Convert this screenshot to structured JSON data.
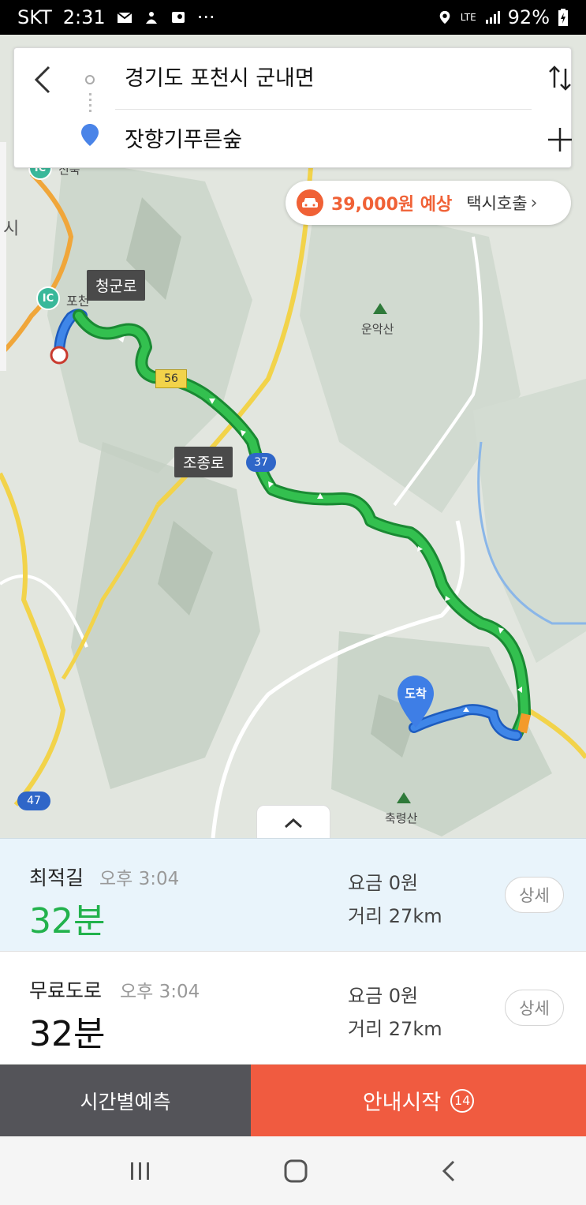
{
  "status_bar": {
    "carrier": "SKT",
    "time": "2:31",
    "more": "···",
    "network": "LTE",
    "battery": "92%"
  },
  "search": {
    "origin": "경기도 포천시 군내면",
    "destination": "잣향기푸른숲"
  },
  "taxi": {
    "fare": "39,000원 예상",
    "call_label": "택시호출",
    "chevron": "›"
  },
  "map": {
    "road_labels": [
      "청군로",
      "조종로"
    ],
    "route_numbers": [
      "56",
      "37",
      "47"
    ],
    "places": [
      "운악산",
      "축령산",
      "포천",
      "신북",
      "시"
    ],
    "ic_label": "IC",
    "arrival_label": "도착",
    "route_color": "#2fb84a",
    "route_outline": "#1f8a34"
  },
  "routes": [
    {
      "name": "최적길",
      "eta": "오후 3:04",
      "duration": "32분",
      "fare": "요금 0원",
      "distance": "거리 27km",
      "detail_label": "상세",
      "duration_color": "#22b24c"
    },
    {
      "name": "무료도로",
      "eta": "오후 3:04",
      "duration": "32분",
      "fare": "요금 0원",
      "distance": "거리 27km",
      "detail_label": "상세",
      "duration_color": "#111111"
    }
  ],
  "actions": {
    "forecast_label": "시간별예측",
    "start_label": "안내시작",
    "countdown": "14"
  },
  "colors": {
    "accent": "#f05b40",
    "taxi": "#f06136",
    "selected_bg": "#e9f4fb"
  }
}
